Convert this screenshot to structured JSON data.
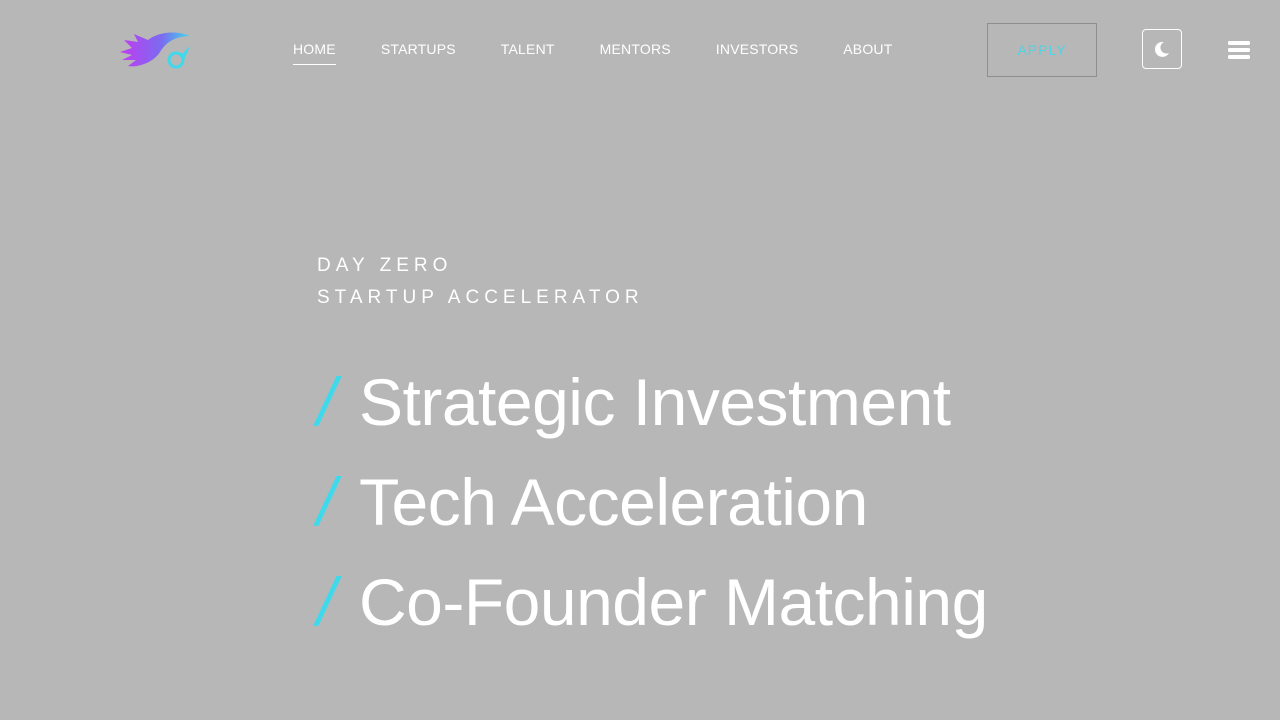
{
  "header": {
    "logo_icon": "comet-rocket-logo-icon",
    "nav": [
      {
        "label": "HOME",
        "active": true
      },
      {
        "label": "STARTUPS",
        "active": false
      },
      {
        "label": "TALENT",
        "active": false
      },
      {
        "label": "MENTORS",
        "active": false
      },
      {
        "label": "INVESTORS",
        "active": false
      },
      {
        "label": "ABOUT",
        "active": false
      }
    ],
    "apply_label": "APPLY",
    "theme_icon": "moon-icon",
    "menu_icon": "hamburger-menu-icon"
  },
  "hero": {
    "eyebrow_line1": "DAY ZERO",
    "eyebrow_line2": "STARTUP ACCELERATOR",
    "slash": "/",
    "headlines": [
      "Strategic Investment",
      "Tech Acceleration",
      "Co-Founder Matching"
    ]
  },
  "colors": {
    "background": "#b7b7b7",
    "accent": "#3fd9ec",
    "text": "#ffffff"
  }
}
